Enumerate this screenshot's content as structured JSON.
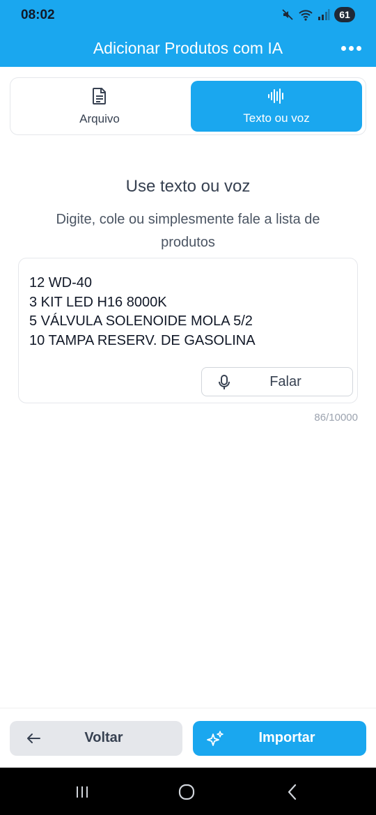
{
  "status_bar": {
    "time": "08:02",
    "battery": "61"
  },
  "app_bar": {
    "title": "Adicionar Produtos com IA"
  },
  "tabs": [
    {
      "label": "Arquivo",
      "icon": "document-icon",
      "active": false
    },
    {
      "label": "Texto ou voz",
      "icon": "waveform-icon",
      "active": true
    }
  ],
  "main": {
    "title": "Use texto ou voz",
    "subtitle": "Digite, cole ou simplesmente fale a lista de produtos",
    "text_value": "12 WD-40\n3 KIT LED H16 8000K\n5 VÁLVULA SOLENOIDE MOLA 5/2\n10 TAMPA RESERV. DE GASOLINA",
    "speak_label": "Falar",
    "char_count": "86/10000"
  },
  "footer": {
    "back_label": "Voltar",
    "import_label": "Importar"
  },
  "colors": {
    "accent": "#1aa7ef",
    "secondary_button": "#e5e7eb",
    "nav_bar": "#000000"
  }
}
